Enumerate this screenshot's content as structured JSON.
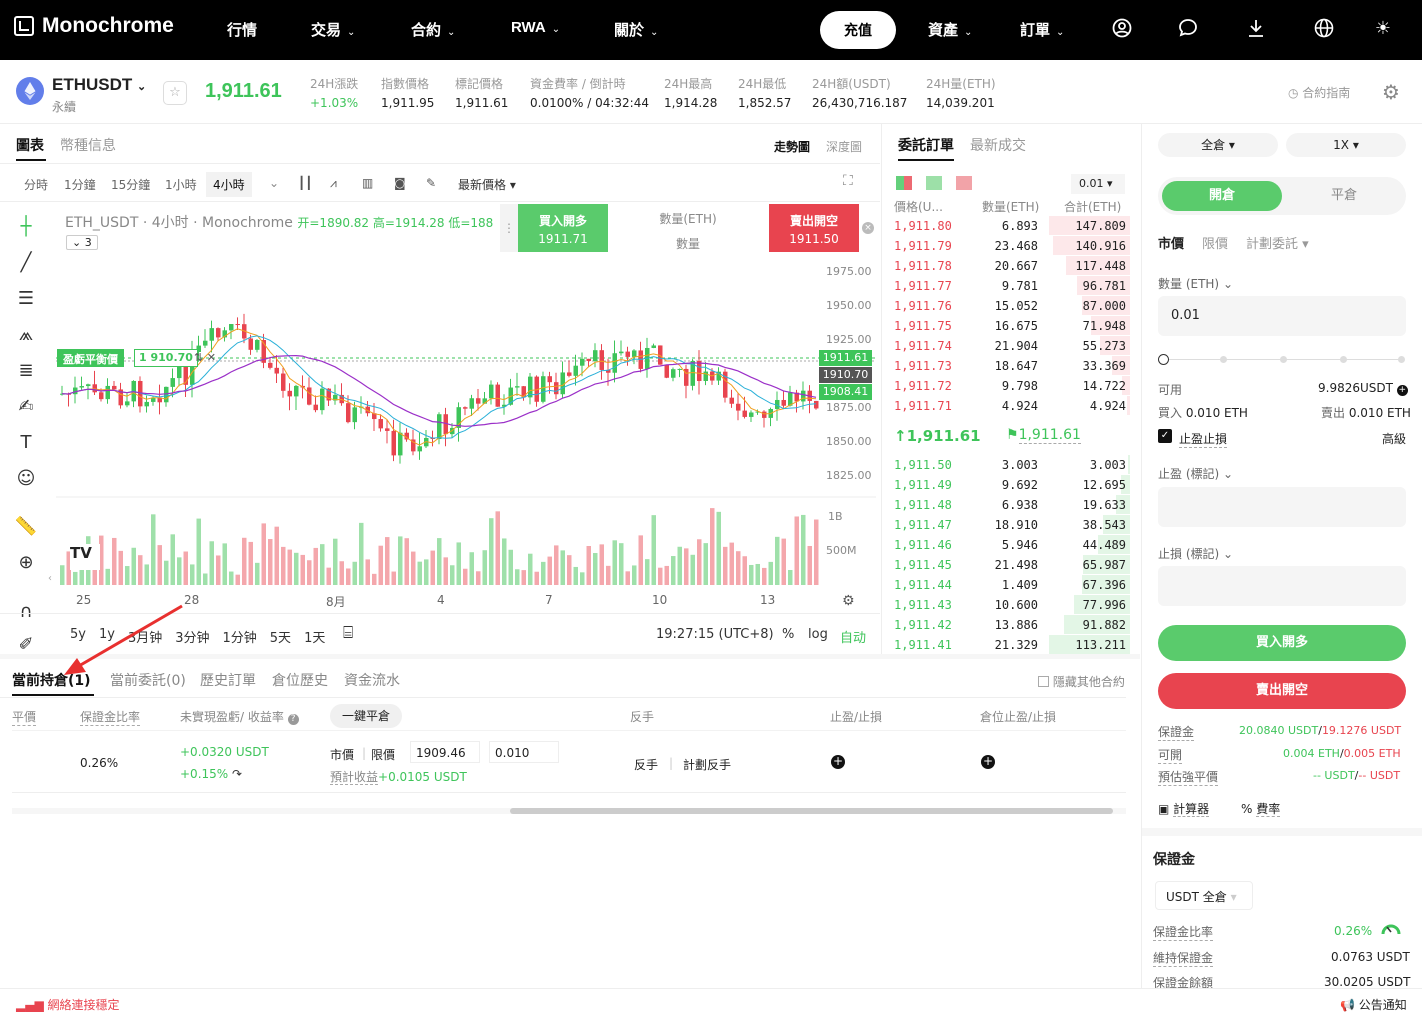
{
  "nav": {
    "logo": "Monochrome",
    "items": [
      "行情",
      "交易",
      "合約",
      "RWA",
      "關於"
    ],
    "deposit": "充值",
    "assets": "資產",
    "orders": "訂單"
  },
  "ticker": {
    "symbol": "ETHUSDT",
    "type": "永續",
    "price": "1,911.61",
    "stats": [
      {
        "label": "24H漲跌",
        "value": "+1.03%"
      },
      {
        "label": "指數價格",
        "value": "1,911.95"
      },
      {
        "label": "標記價格",
        "value": "1,911.61"
      },
      {
        "label": "資金費率 / 倒計時",
        "value": "0.0100% / 04:32:44"
      },
      {
        "label": "24H最高",
        "value": "1,914.28"
      },
      {
        "label": "24H最低",
        "value": "1,852.57"
      },
      {
        "label": "24H額(USDT)",
        "value": "26,430,716.187"
      },
      {
        "label": "24H量(ETH)",
        "value": "14,039.201"
      }
    ],
    "guide": "合約指南"
  },
  "chart": {
    "tabs": [
      "圖表",
      "幣種信息"
    ],
    "views": [
      "走勢圖",
      "深度圖"
    ],
    "intervals": [
      "分時",
      "1分鐘",
      "15分鐘",
      "1小時",
      "4小時"
    ],
    "price_type": "最新價格",
    "legend": "ETH_USDT · 4小时 · Monochrome",
    "ohlc": "开=1890.82 高=1914.28 低=188",
    "indicator_count": "3",
    "buy_btn": "買入開多",
    "buy_price": "1911.71",
    "sell_btn": "賣出開空",
    "sell_price": "1911.50",
    "qty_label": "數量(ETH)",
    "qty_sub": "數量",
    "pnl_label": "盈虧平衡價",
    "pnl_value": "1 910.70",
    "price_axis": [
      "1975.00",
      "1950.00",
      "1925.00",
      "1875.00",
      "1850.00",
      "1825.00"
    ],
    "vol_axis": [
      "1B",
      "500M"
    ],
    "tags": [
      "1911.61",
      "1910.70",
      "1908.41"
    ],
    "x_axis": [
      "25",
      "28",
      "8月",
      "4",
      "7",
      "10",
      "13"
    ],
    "ranges": [
      "5y",
      "1y",
      "3月钟",
      "3分钟",
      "1分钟",
      "5天",
      "1天"
    ],
    "time": "19:27:15 (UTC+8)",
    "pct": "%",
    "log": "log",
    "auto": "自动"
  },
  "orderbook": {
    "tabs": [
      "委託訂單",
      "最新成交"
    ],
    "precision": "0.01",
    "headers": [
      "價格(U...",
      "數量(ETH)",
      "合計(ETH)"
    ],
    "asks": [
      [
        "1,911.80",
        "6.893",
        "147.809"
      ],
      [
        "1,911.79",
        "23.468",
        "140.916"
      ],
      [
        "1,911.78",
        "20.667",
        "117.448"
      ],
      [
        "1,911.77",
        "9.781",
        "96.781"
      ],
      [
        "1,911.76",
        "15.052",
        "87.000"
      ],
      [
        "1,911.75",
        "16.675",
        "71.948"
      ],
      [
        "1,911.74",
        "21.904",
        "55.273"
      ],
      [
        "1,911.73",
        "18.647",
        "33.369"
      ],
      [
        "1,911.72",
        "9.798",
        "14.722"
      ],
      [
        "1,911.71",
        "4.924",
        "4.924"
      ]
    ],
    "last": "1,911.61",
    "mark": "1,911.61",
    "bids": [
      [
        "1,911.50",
        "3.003",
        "3.003"
      ],
      [
        "1,911.49",
        "9.692",
        "12.695"
      ],
      [
        "1,911.48",
        "6.938",
        "19.633"
      ],
      [
        "1,911.47",
        "18.910",
        "38.543"
      ],
      [
        "1,911.46",
        "5.946",
        "44.489"
      ],
      [
        "1,911.45",
        "21.498",
        "65.987"
      ],
      [
        "1,911.44",
        "1.409",
        "67.396"
      ],
      [
        "1,911.43",
        "10.600",
        "77.996"
      ],
      [
        "1,911.42",
        "13.886",
        "91.882"
      ],
      [
        "1,911.41",
        "21.329",
        "113.211"
      ]
    ]
  },
  "trade": {
    "margin_mode": "全倉",
    "leverage": "1X",
    "open": "開倉",
    "close": "平倉",
    "types": [
      "市價",
      "限價",
      "計劃委託"
    ],
    "qty_label": "數量 (ETH)",
    "qty": "0.01",
    "avail_label": "可用",
    "avail": "9.9826USDT",
    "buy_label": "買入",
    "buy_val": "0.010 ETH",
    "sell_label": "賣出",
    "sell_val": "0.010 ETH",
    "tpsl": "止盈止損",
    "advanced": "高級",
    "tp_label": "止盈 (標記)",
    "sl_label": "止損 (標記)",
    "buy_btn": "買入開多",
    "sell_btn": "賣出開空",
    "margin_label": "保證金",
    "margin_buy": "20.0840 USDT",
    "margin_sell": "19.1276 USDT",
    "avail2_label": "可開",
    "avail2_buy": "0.004 ETH",
    "avail2_sell": "0.005 ETH",
    "liq_label": "預估強平價",
    "liq_buy": "-- USDT",
    "liq_sell": "-- USDT",
    "calculator": "計算器",
    "fee": "費率"
  },
  "margin": {
    "title": "保證金",
    "mode": "USDT 全倉",
    "ratio_label": "保證金比率",
    "ratio": "0.26%",
    "maint_label": "維持保證金",
    "maint": "0.0763 USDT",
    "balance_label": "保證金餘額",
    "balance": "30.0205 USDT"
  },
  "positions": {
    "tabs": [
      "當前持倉(1)",
      "當前委託(0)",
      "歷史訂單",
      "倉位歷史",
      "資金流水"
    ],
    "hide_other": "隱藏其他合約",
    "headers": [
      "平價",
      "保證金比率",
      "未實現盈虧/ 收益率",
      "一鍵平倉",
      "反手",
      "止盈/止損",
      "倉位止盈/止損"
    ],
    "row": {
      "margin_ratio": "0.26%",
      "pnl": "+0.0320 USDT",
      "roe": "+0.15%",
      "market": "市價",
      "limit": "限價",
      "price": "1909.46",
      "qty": "0.010",
      "est": "預計收益",
      "est_val": "+0.0105 USDT",
      "reverse": "反手",
      "plan_reverse": "計劃反手"
    }
  },
  "status": {
    "connection": "網絡連接穩定",
    "notice": "公告通知"
  },
  "colors": {
    "green": "#3ec45a",
    "red": "#e8444f",
    "accent": "#000000"
  }
}
